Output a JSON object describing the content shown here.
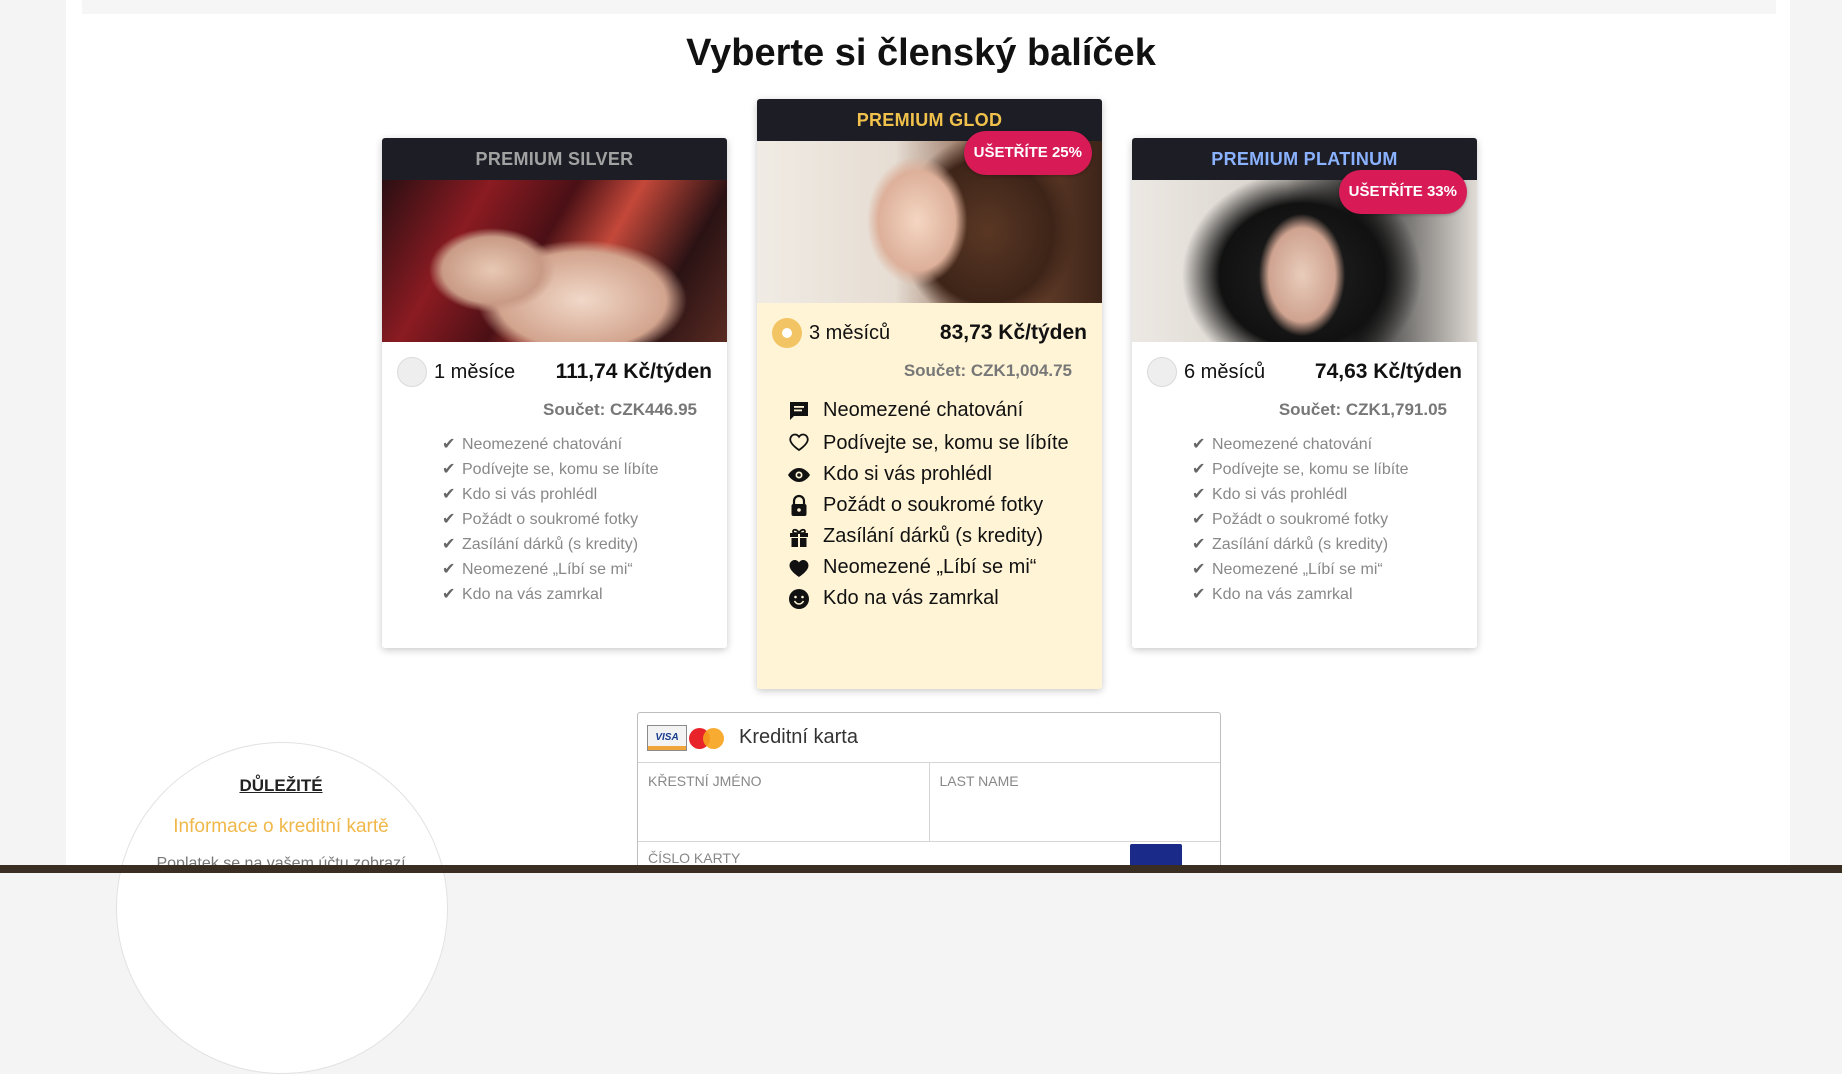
{
  "page": {
    "title": "Vyberte si členský balíček"
  },
  "plans": [
    {
      "name": "PREMIUM SILVER",
      "duration": "1 měsíce",
      "price": "111,74 Kč/týden",
      "total": "Součet: CZK446.95",
      "badge": "",
      "selected": false,
      "features": [
        "Neomezené chatování",
        "Podívejte se, komu se líbíte",
        "Kdo si vás prohlédl",
        "Požádt o soukromé fotky",
        "Zasílání dárků (s kredity)",
        "Neomezené „Líbí se mi“",
        "Kdo na vás zamrkal"
      ]
    },
    {
      "name": "PREMIUM GLOD",
      "duration": "3 měsíců",
      "price": "83,73 Kč/týden",
      "total": "Součet: CZK1,004.75",
      "badge": "UŠETŘÍTE 25%",
      "selected": true,
      "features": [
        "Neomezené chatování",
        "Podívejte se, komu se líbíte",
        "Kdo si vás prohlédl",
        "Požádt o soukromé fotky",
        "Zasílání dárků (s kredity)",
        "Neomezené „Líbí se mi“",
        "Kdo na vás zamrkal"
      ],
      "feature_icons": [
        "chat-icon",
        "heart-outline-icon",
        "eye-icon",
        "lock-icon",
        "gift-icon",
        "heart-icon",
        "smile-icon"
      ]
    },
    {
      "name": "PREMIUM PLATINUM",
      "duration": "6 měsíců",
      "price": "74,63 Kč/týden",
      "total": "Součet: CZK1,791.05",
      "badge": "UŠETŘÍTE 33%",
      "selected": false,
      "features": [
        "Neomezené chatování",
        "Podívejte se, komu se líbíte",
        "Kdo si vás prohlédl",
        "Požádt o soukromé fotky",
        "Zasílání dárků (s kredity)",
        "Neomezené „Líbí se mi“",
        "Kdo na vás zamrkal"
      ]
    }
  ],
  "payment": {
    "method": "Kreditní karta",
    "visa_label": "VISA",
    "first_name_label": "KŘESTNÍ JMÉNO",
    "last_name_label": "LAST NAME",
    "card_number_label": "ČÍSLO KARTY"
  },
  "info": {
    "heading": "DŮLEŽITÉ",
    "subheading": "Informace o kreditní kartě",
    "note": "Poplatek se na vašem účtu zobrazí"
  },
  "colors": {
    "header_dark": "#1d1d26",
    "gold": "#f0c14b",
    "silver": "#a2a2a2",
    "platinum": "#8ab2ff",
    "badge": "#d81b57",
    "gold_card_bg": "#fff4d6"
  }
}
